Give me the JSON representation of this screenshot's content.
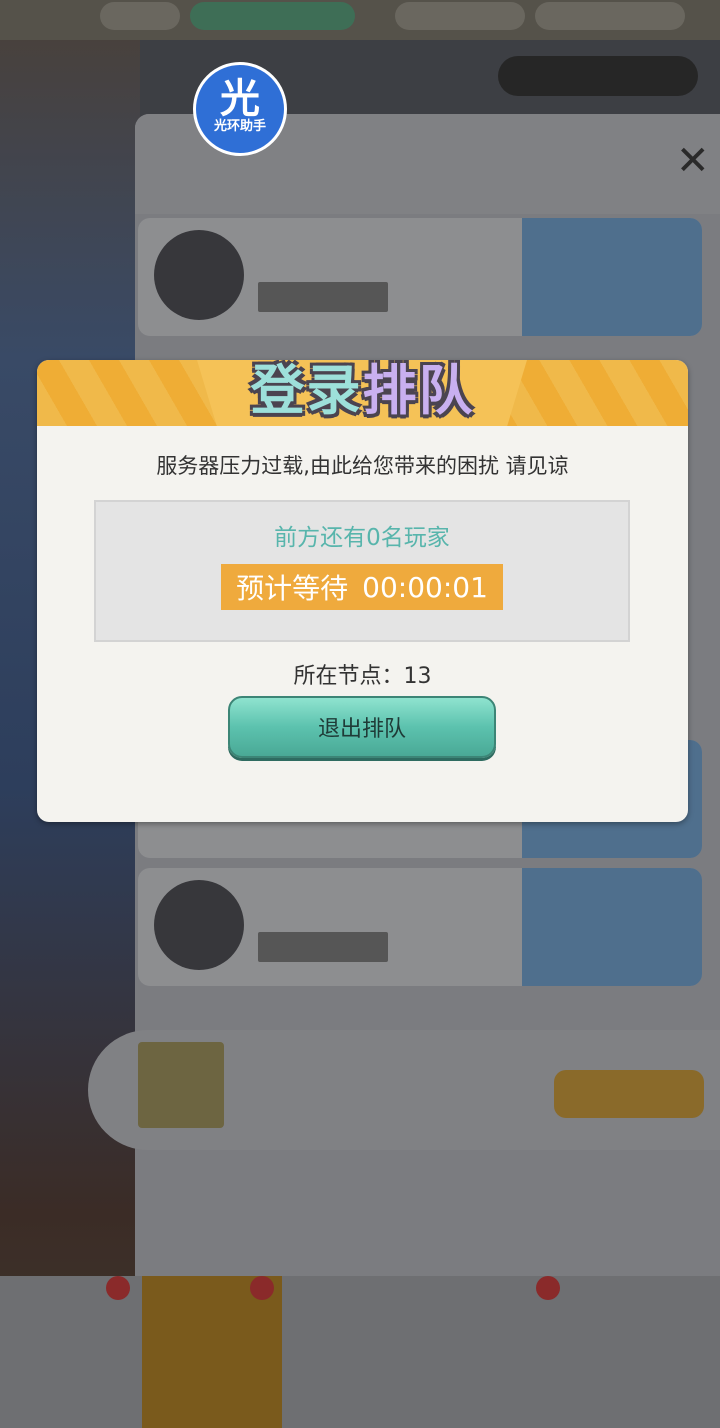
{
  "helper_logo": {
    "glyph": "光",
    "caption": "光环助手"
  },
  "modal": {
    "title_part1": "登录",
    "title_part2": "排队",
    "message": "服务器压力过载,由此给您带来的困扰 请见谅",
    "queue_text": "前方还有0名玩家",
    "wait_label": "预计等待",
    "wait_time": "00:00:01",
    "node_text": "所在节点：13",
    "exit_button": "退出排队"
  },
  "colors": {
    "accent_orange": "#efaa3d",
    "teal_text": "#58b5ac",
    "button_teal": "#5cc2ae"
  }
}
